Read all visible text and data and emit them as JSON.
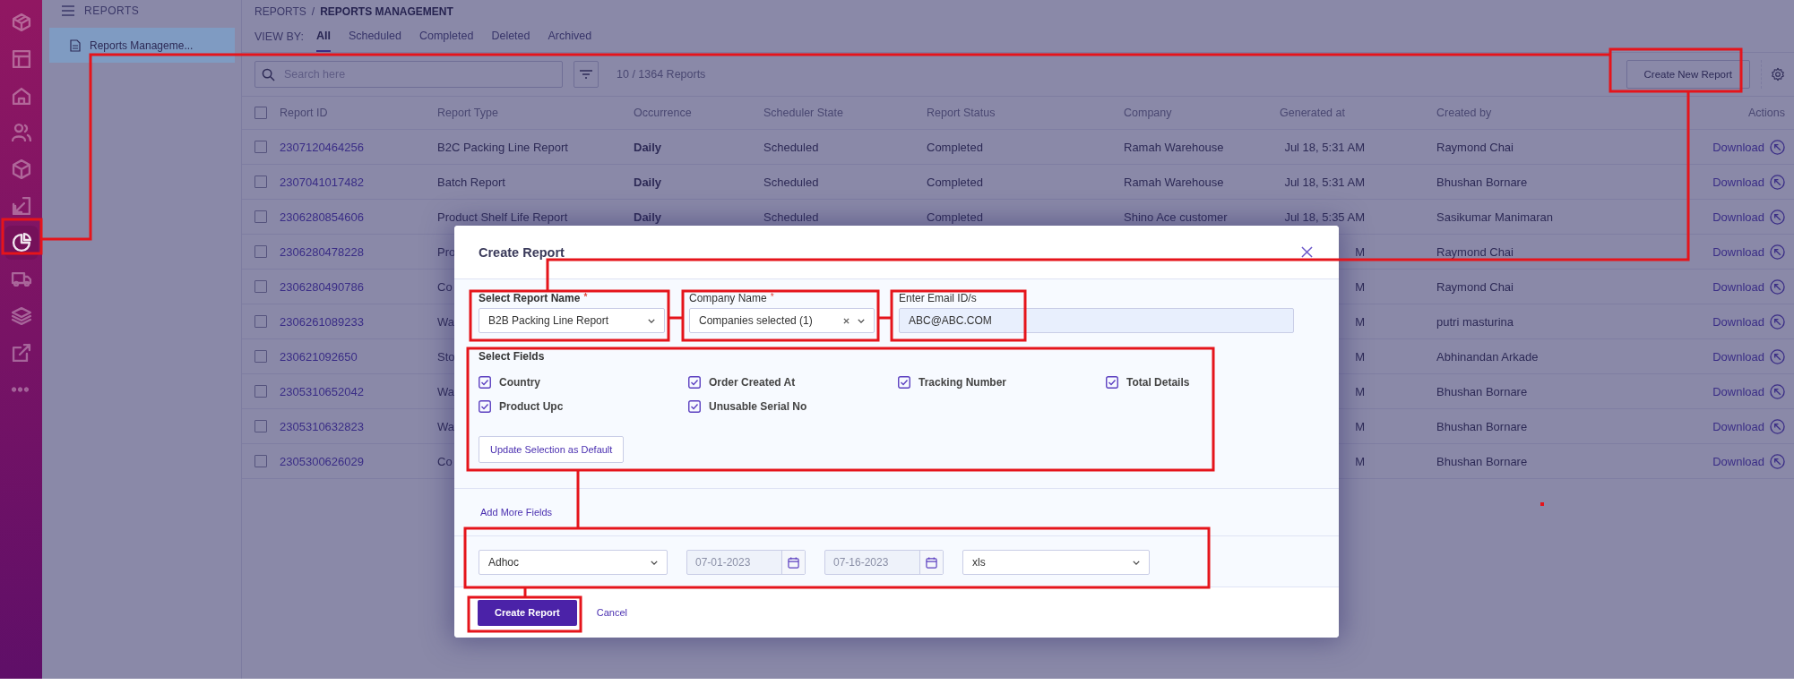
{
  "rail": {
    "items": [
      {
        "kind": "logo",
        "selected": false
      },
      {
        "kind": "layout",
        "selected": false
      },
      {
        "kind": "home",
        "selected": false
      },
      {
        "kind": "users",
        "selected": false
      },
      {
        "kind": "box",
        "selected": false
      },
      {
        "kind": "inbound",
        "selected": false
      },
      {
        "kind": "pie",
        "selected": true
      },
      {
        "kind": "truck",
        "selected": false
      },
      {
        "kind": "layers",
        "selected": false
      },
      {
        "kind": "external",
        "selected": false
      },
      {
        "kind": "more",
        "selected": false
      }
    ]
  },
  "sidebar": {
    "title": "REPORTS",
    "items": [
      {
        "label": "Reports Manageme...",
        "selected": true
      }
    ]
  },
  "breadcrumb": {
    "items": [
      "REPORTS",
      "REPORTS MANAGEMENT"
    ],
    "separator": "/"
  },
  "view_by": {
    "label": "VIEW BY:",
    "tabs": [
      {
        "label": "All",
        "selected": true
      },
      {
        "label": "Scheduled",
        "selected": false
      },
      {
        "label": "Completed",
        "selected": false
      },
      {
        "label": "Deleted",
        "selected": false
      },
      {
        "label": "Archived",
        "selected": false
      }
    ]
  },
  "search": {
    "placeholder": "Search here"
  },
  "count": "10 / 1364 Reports",
  "create_button": "Create New Report",
  "table": {
    "header_checked": false,
    "columns": [
      "Report ID",
      "Report Type",
      "Occurrence",
      "Scheduler State",
      "Report Status",
      "Company",
      "Generated at",
      "Created by",
      "Actions"
    ],
    "rows": [
      {
        "checked": false,
        "id": "2307120464256",
        "type": "B2C Packing Line Report",
        "occurrence": "Daily",
        "scheduler_state": "Scheduled",
        "status": "Completed",
        "company": "Ramah Warehouse",
        "generated_at": "Jul 18, 5:31 AM",
        "created_by": "Raymond Chai",
        "action": "Download"
      },
      {
        "checked": false,
        "id": "2307041017482",
        "type": "Batch Report",
        "occurrence": "Daily",
        "scheduler_state": "Scheduled",
        "status": "Completed",
        "company": "Ramah Warehouse",
        "generated_at": "Jul 18, 5:31 AM",
        "created_by": "Bhushan Bornare",
        "action": "Download"
      },
      {
        "checked": false,
        "id": "2306280854606",
        "type": "Product Shelf Life Report",
        "occurrence": "Daily",
        "scheduler_state": "Scheduled",
        "status": "Completed",
        "company": "Shino Ace customer",
        "generated_at": "Jul 18, 5:35 AM",
        "created_by": "Sasikumar Manimaran",
        "action": "Download"
      },
      {
        "checked": false,
        "id": "2306280478228",
        "type": "Pro",
        "generated_at": "M",
        "created_by": "Raymond Chai",
        "action": "Download"
      },
      {
        "checked": false,
        "id": "2306280490786",
        "type": "Co",
        "generated_at": "M",
        "created_by": "Raymond Chai",
        "action": "Download"
      },
      {
        "checked": false,
        "id": "2306261089233",
        "type": "Wa",
        "generated_at": "M",
        "created_by": "putri masturina",
        "action": "Download"
      },
      {
        "checked": false,
        "id": "230621092650",
        "type": "Sto",
        "generated_at": "M",
        "created_by": "Abhinandan Arkade",
        "action": "Download"
      },
      {
        "checked": false,
        "id": "2305310652042",
        "type": "Wa",
        "generated_at": "M",
        "created_by": "Bhushan Bornare",
        "action": "Download"
      },
      {
        "checked": false,
        "id": "2305310632823",
        "type": "Wa",
        "generated_at": "M",
        "created_by": "Bhushan Bornare",
        "action": "Download"
      },
      {
        "checked": false,
        "id": "2305300626029",
        "type": "Co",
        "generated_at": "M",
        "created_by": "Bhushan Bornare",
        "action": "Download"
      }
    ]
  },
  "modal": {
    "title": "Create Report",
    "fields": [
      {
        "kind": "select",
        "label": "Select Report Name",
        "required_mark": "*",
        "value": "B2B Packing Line Report"
      },
      {
        "kind": "multiselect",
        "label": "Company Name",
        "required_mark": "*",
        "value": "Companies selected (1)"
      },
      {
        "kind": "text",
        "label": "Enter Email ID/s",
        "value": "ABC@ABC.COM"
      }
    ],
    "select_fields": {
      "label": "Select Fields",
      "options": [
        {
          "label": "Country",
          "checked": true
        },
        {
          "label": "Order Created At",
          "checked": true
        },
        {
          "label": "Tracking Number",
          "checked": true
        },
        {
          "label": "Total Details",
          "checked": true
        },
        {
          "label": "Product Upc",
          "checked": true
        },
        {
          "label": "Unusable Serial No",
          "checked": true
        }
      ],
      "default_button": "Update Selection as Default"
    },
    "add_more": "Add More Fields",
    "schedule": [
      {
        "kind": "select",
        "value": "Adhoc",
        "disabled": false
      },
      {
        "kind": "date",
        "value": "07-01-2023",
        "disabled": true
      },
      {
        "kind": "date",
        "value": "07-16-2023",
        "disabled": true
      },
      {
        "kind": "select",
        "value": "xls",
        "disabled": false
      }
    ],
    "primary_button": "Create Report",
    "cancel": "Cancel"
  }
}
